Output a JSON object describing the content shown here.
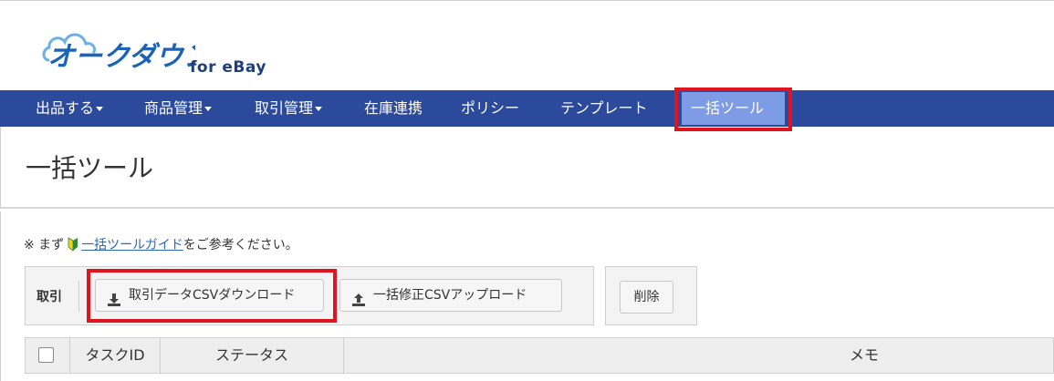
{
  "logo": {
    "main_text": "オークダウン",
    "suffix": "for eBay",
    "icon": "cloud-logo-icon"
  },
  "nav": {
    "items": [
      {
        "label": "出品する",
        "dropdown": true
      },
      {
        "label": "商品管理",
        "dropdown": true
      },
      {
        "label": "取引管理",
        "dropdown": true
      },
      {
        "label": "在庫連携",
        "dropdown": false
      },
      {
        "label": "ポリシー",
        "dropdown": false
      },
      {
        "label": "テンプレート",
        "dropdown": false
      },
      {
        "label": "一括ツール",
        "dropdown": false,
        "active": true
      }
    ],
    "background": "#2c4a9c",
    "active_color": "#7e9be6",
    "highlight_color": "#e0141f"
  },
  "page": {
    "title": "一括ツール"
  },
  "notice": {
    "prefix": "※ まず",
    "icon": "beginner-leaf-icon",
    "link": "一括ツールガイド",
    "suffix": "をご参考ください。"
  },
  "toolbar": {
    "group_label": "取引",
    "download_label": "取引データCSVダウンロード",
    "download_icon": "download-icon",
    "upload_label": "一括修正CSVアップロード",
    "upload_icon": "upload-icon",
    "delete_label": "削除"
  },
  "table": {
    "columns": [
      "",
      "タスクID",
      "ステータス",
      "メモ"
    ]
  }
}
